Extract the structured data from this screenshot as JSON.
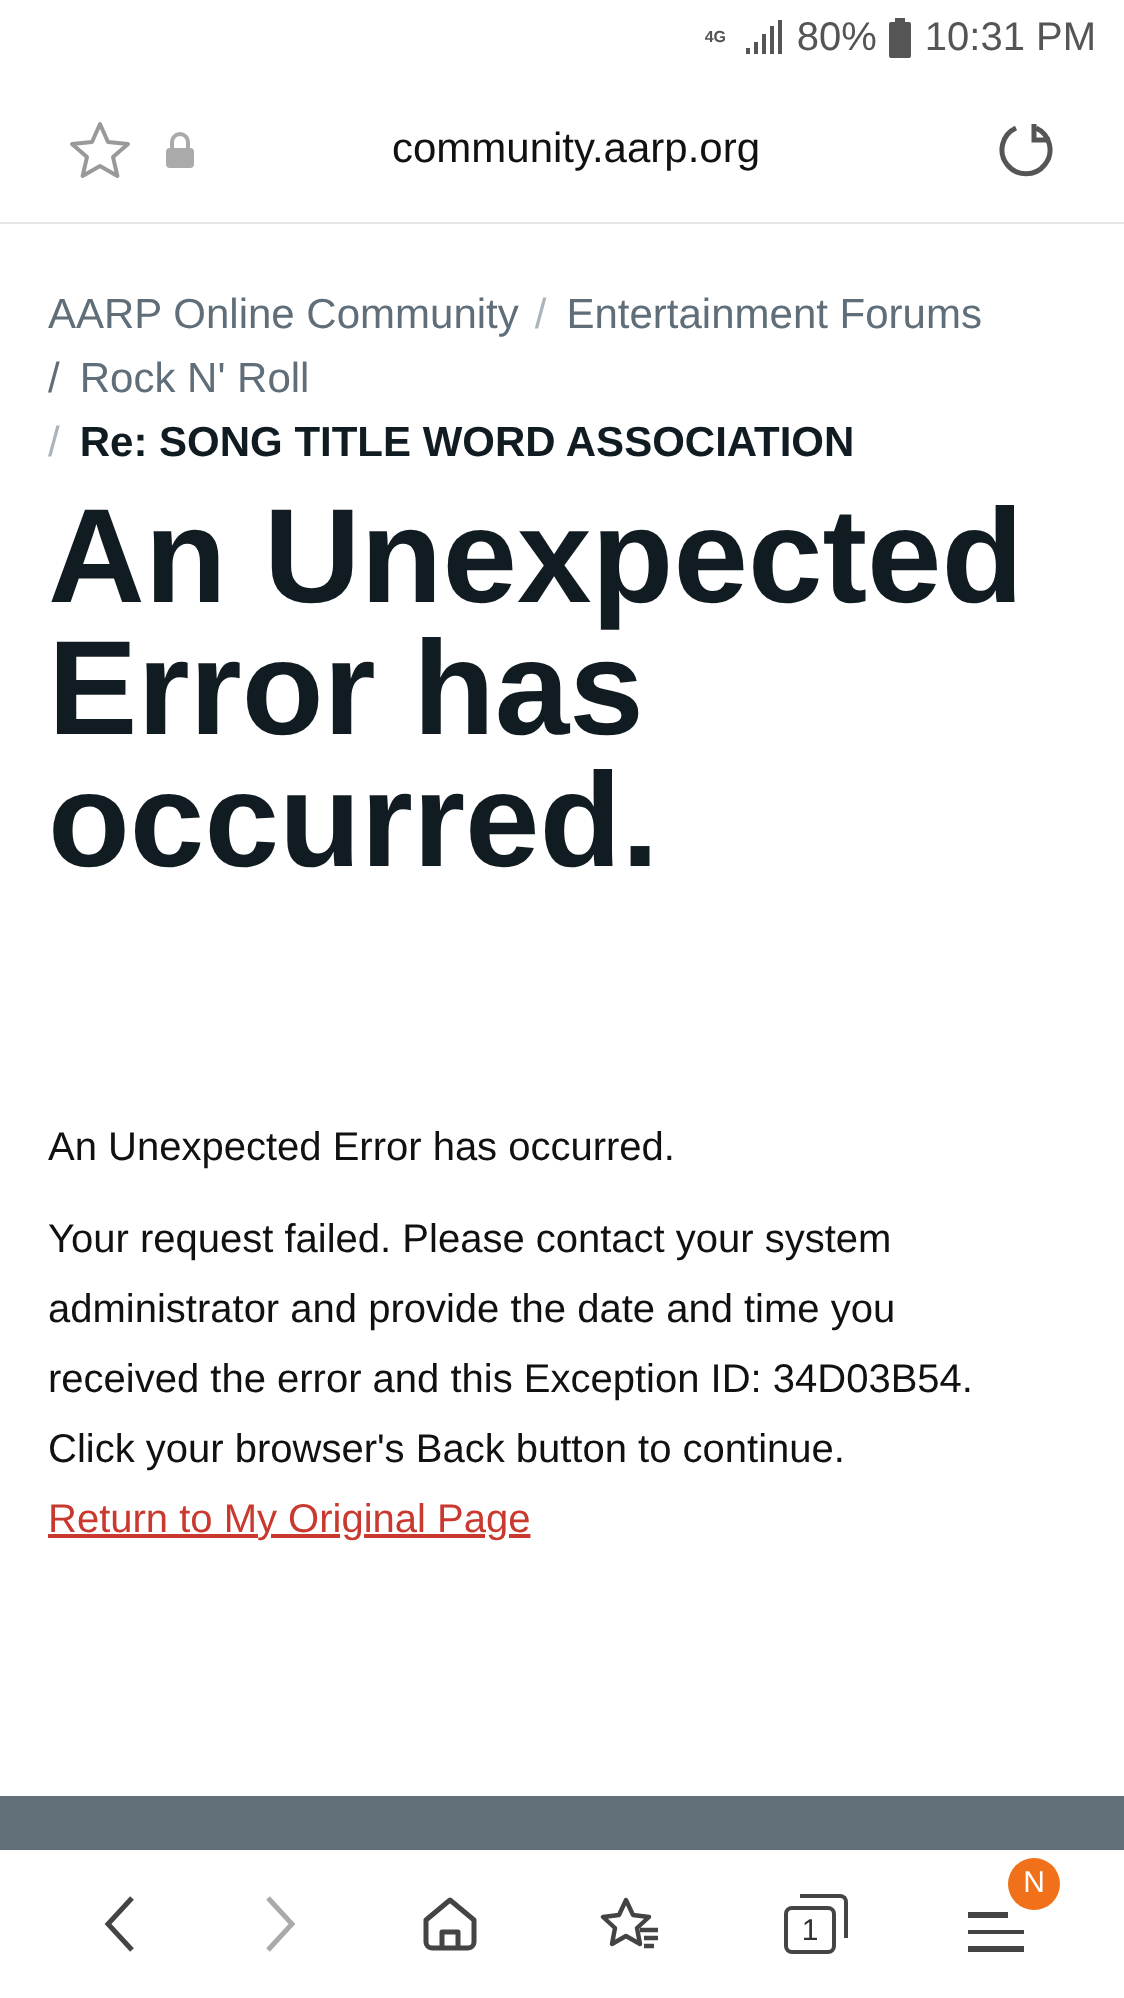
{
  "status_bar": {
    "network": "4G",
    "battery": "80%",
    "time": "10:31 PM"
  },
  "address_bar": {
    "url": "community.aarp.org"
  },
  "breadcrumbs": [
    {
      "label": "AARP Online Community",
      "current": false
    },
    {
      "separator": "/",
      "label": "Entertainment Forums",
      "current": false
    },
    {
      "separator": "/",
      "label": "Rock N' Roll",
      "current": false
    },
    {
      "separator": "/",
      "label": "Re: SONG TITLE WORD ASSOCIATION",
      "current": true
    }
  ],
  "heading": "An Unexpected Error has occurred.",
  "message": "An Unexpected Error has occurred.",
  "details": [
    "Your request failed. Please contact your system administrator and provide the date and time you received the error and this Exception ID: 34D03B54.",
    "Click your browser's Back button to continue."
  ],
  "return_link": "Return to My Original Page",
  "toolbar": {
    "back_disabled": false,
    "forward_disabled": true,
    "tab_count": "1",
    "menu_badge": "N"
  }
}
